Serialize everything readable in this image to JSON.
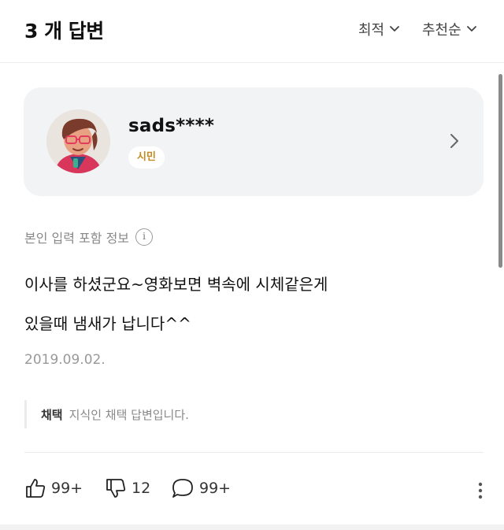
{
  "header": {
    "title": "3 개 답변",
    "sort_options": [
      "최적",
      "추천순"
    ]
  },
  "profile": {
    "username": "sads****",
    "badge": "시민"
  },
  "answer": {
    "info_label": "본인 입력 포함 정보",
    "info_icon_glyph": "i",
    "body_lines": [
      "이사를 하셨군요~영화보면 벽속에 시체같은게",
      "있을때 냄새가 납니다^^"
    ],
    "date": "2019.09.02.",
    "selected": {
      "label": "채택",
      "text": "지식인 채택 답변입니다."
    }
  },
  "actions": {
    "like_count": "99+",
    "dislike_count": "12",
    "comment_count": "99+"
  },
  "colors": {
    "card_bg": "#f2f3f5",
    "badge_text": "#c48a1e",
    "muted_text": "#888888"
  },
  "icons": [
    "chevron-down-icon",
    "chevron-right-icon",
    "info-icon",
    "thumbs-up-icon",
    "thumbs-down-icon",
    "comment-icon",
    "more-vertical-icon"
  ]
}
